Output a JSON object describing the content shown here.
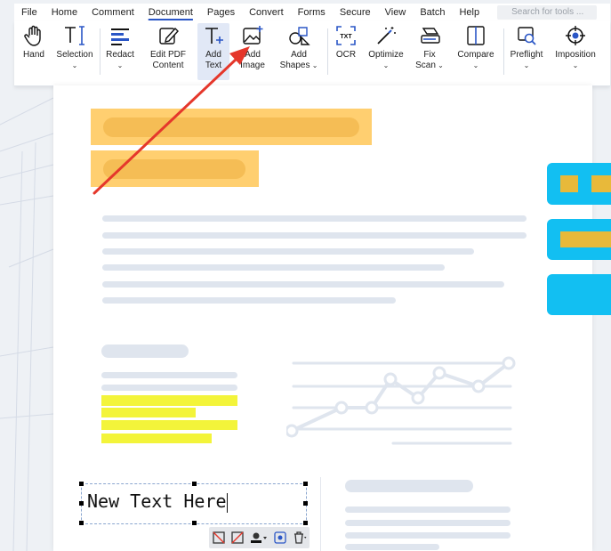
{
  "menu": {
    "items": [
      "File",
      "Home",
      "Comment",
      "Document",
      "Pages",
      "Convert",
      "Forms",
      "Secure",
      "View",
      "Batch",
      "Help"
    ],
    "active": "Document",
    "search_placeholder": "Search for tools ..."
  },
  "ribbon": {
    "hand": "Hand",
    "selection": "Selection",
    "redact": "Redact",
    "edit_pdf_1": "Edit PDF",
    "edit_pdf_2": "Content",
    "add_text_1": "Add",
    "add_text_2": "Text",
    "add_image_1": "Add",
    "add_image_2": "Image",
    "add_shapes_1": "Add",
    "add_shapes_2": "Shapes",
    "ocr": "OCR",
    "optimize": "Optimize",
    "fix_scan_1": "Fix",
    "fix_scan_2": "Scan",
    "compare": "Compare",
    "preflight": "Preflight",
    "imposition": "Imposition"
  },
  "colors": {
    "accent": "#2a56c6",
    "highlight_orange": "#ffcf70",
    "highlight_yellow": "#f3f43a",
    "side_tab": "#12bff2",
    "side_tab_fill": "#e8b93a",
    "arrow": "#e5372b"
  },
  "editor": {
    "textbox_value": "New Text Here"
  }
}
